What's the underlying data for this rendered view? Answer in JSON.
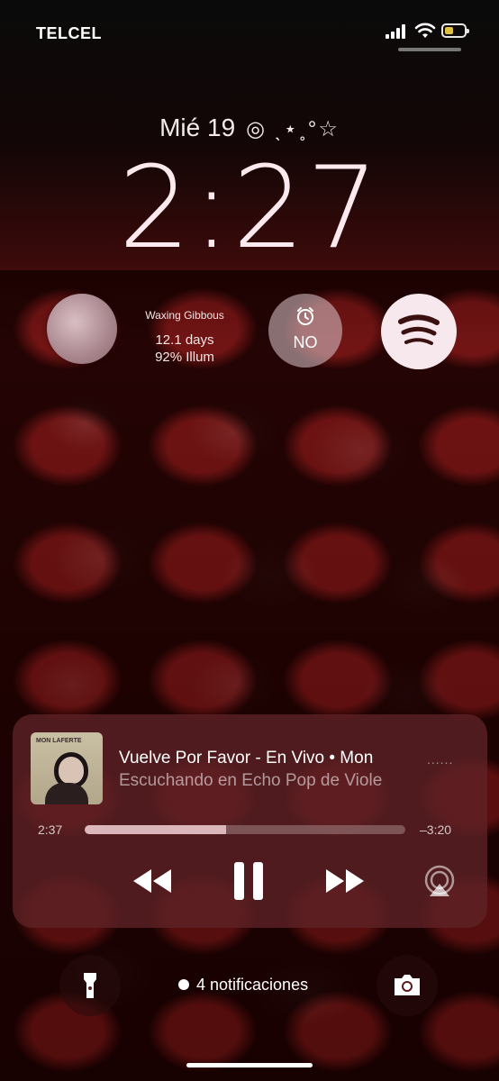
{
  "status_bar": {
    "carrier": "TELCEL",
    "battery_color": "#f5d54a"
  },
  "lockscreen": {
    "date": "Mié 19",
    "date_deco": "◎ ˎ⋆˳°☆",
    "time": "2:27"
  },
  "widgets": {
    "moon": {
      "phase": "Waxing Gibbous",
      "days": "12.1 days",
      "illumination": "92% Illum"
    },
    "alarm": {
      "label": "NO"
    },
    "spotify": {
      "icon": "spotify-icon"
    }
  },
  "now_playing": {
    "title": "Vuelve Por Favor - En Vivo • Mon",
    "subtitle": "Escuchando en Echo Pop de Viole",
    "album_text": "MON LAFERTE",
    "elapsed": "2:37",
    "remaining": "–3:20",
    "progress_fraction": 0.44,
    "dots": "......"
  },
  "bottom": {
    "notifications": "4 notificaciones"
  }
}
